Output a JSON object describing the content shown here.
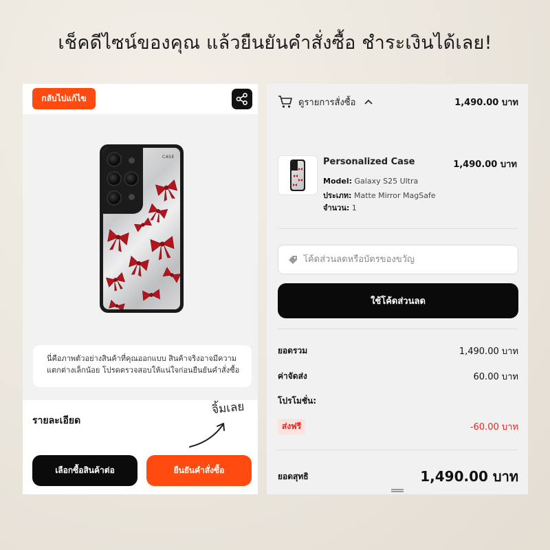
{
  "headline": "เช็คดีไซน์ของคุณ แล้วยืนยันคำสั่งซื้อ ชำระเงินได้เลย!",
  "left": {
    "back_label": "กลับไปแก้ไข",
    "share_icon": "share-icon",
    "case_brand_mark": "CASE",
    "notice": "นี่คือภาพตัวอย่างสินค้าที่คุณออกแบบ สินค้าจริงอาจมีความแตกต่างเล็กน้อย โปรดตรวจสอบให้แน่ใจก่อนยืนยันคำสั่งซื้อ",
    "details_label": "รายละเอียด",
    "continue_label": "เลือกซื้อสินค้าต่อ",
    "confirm_label": "ยืนยันคำสั่งซื้อ",
    "annotation": "จิ้มเลย"
  },
  "right": {
    "summary_label": "ดูรายการสั่งซื้อ",
    "summary_total": "1,490.00 บาท",
    "product": {
      "name": "Personalized Case",
      "price": "1,490.00 บาท",
      "model_label": "Model:",
      "model_value": "Galaxy S25 Ultra",
      "type_label": "ประเภท:",
      "type_value": "Matte Mirror MagSafe",
      "qty_label": "จำนวน:",
      "qty_value": "1"
    },
    "coupon_placeholder": "โค้ดส่วนลดหรือบัตรของขวัญ",
    "apply_label": "ใช้โค้ดส่วนลด",
    "subtotal_label": "ยอดรวม",
    "subtotal_value": "1,490.00 บาท",
    "shipping_label": "ค่าจัดส่ง",
    "shipping_value": "60.00 บาท",
    "promo_label": "โปรโมชั่น:",
    "free_shipping_label": "ส่งฟรี",
    "discount_value": "-60.00 บาท",
    "grand_label": "ยอดสุทธิ",
    "grand_value": "1,490.00 บาท"
  },
  "colors": {
    "accent": "#ff4a10",
    "dark": "#0a0a0a",
    "discount": "#e8241c",
    "bow": "#b3151c"
  }
}
